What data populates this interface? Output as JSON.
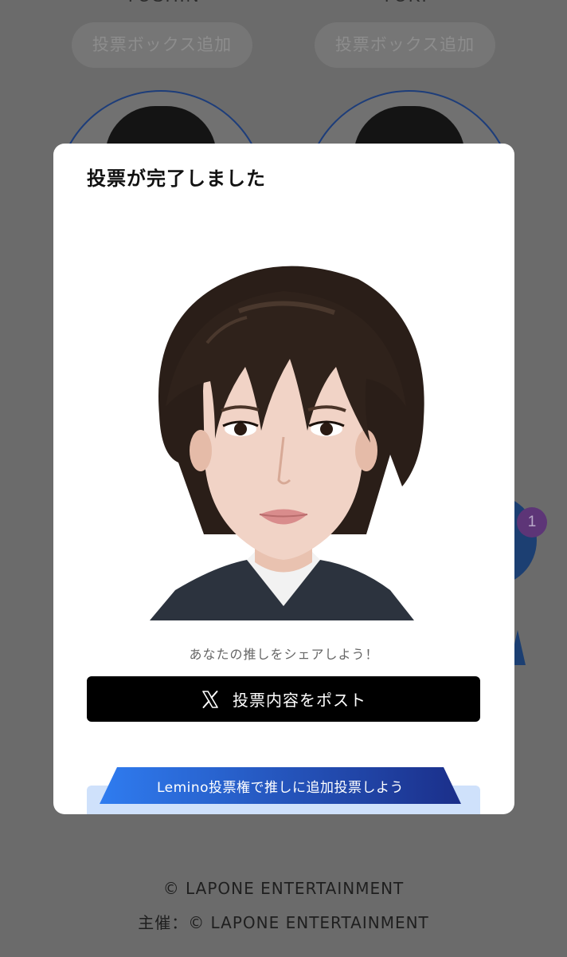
{
  "background": {
    "cards": [
      {
        "name": "YUSHIN",
        "add_button_label": "投票ボックス追加"
      },
      {
        "name": "YUKI",
        "add_button_label": "投票ボックス追加"
      }
    ],
    "vote_box_count": "1"
  },
  "modal": {
    "title": "投票が完了しました",
    "share_prompt": "あなたの推しをシェアしよう！",
    "post_button": {
      "label": "投票内容をポスト",
      "icon": "x-logo-icon"
    },
    "promo_banner_label": "Lemino投票権で推しに追加投票しよう"
  },
  "footer": {
    "copyright": "© LAPONE ENTERTAINMENT",
    "organizer": "主催：© LAPONE ENTERTAINMENT"
  },
  "colors": {
    "overlay": "#6b6b6b",
    "modal_bg": "#ffffff",
    "post_button": "#000000",
    "promo_gradient_start": "#2f7cf0",
    "promo_gradient_end": "#1b2f8a",
    "promo_panel": "#cfe1fb"
  }
}
